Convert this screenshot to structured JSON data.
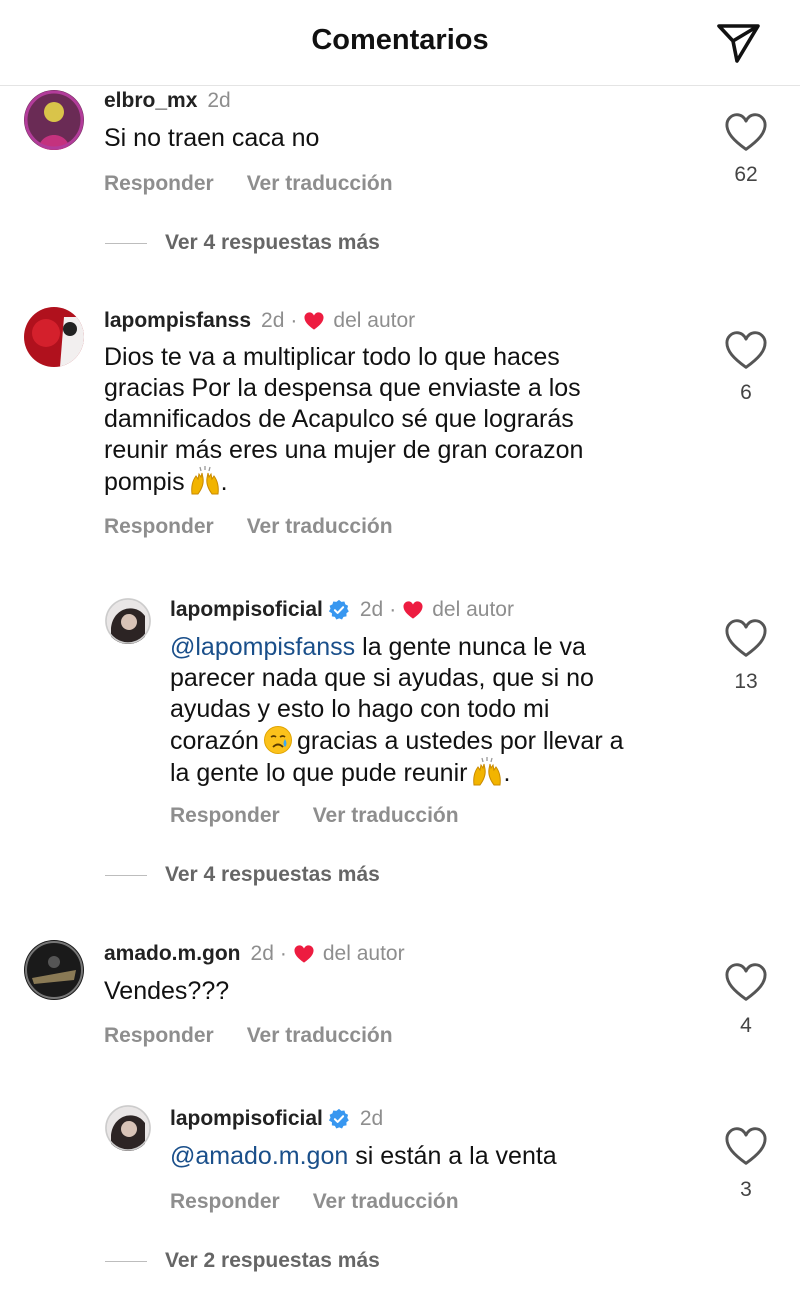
{
  "header": {
    "title": "Comentarios"
  },
  "labels": {
    "reply": "Responder",
    "translate": "Ver traducción",
    "author": "del autor"
  },
  "comments": [
    {
      "user": "elbro_mx",
      "time": "2d",
      "text": "Si no traen caca no",
      "likes": "62",
      "more_replies": "Ver 4 respuestas más"
    },
    {
      "user": "lapompisfanss",
      "time": "2d",
      "liked_by_author": true,
      "lines": [
        "Dios te va a multiplicar todo lo que haces",
        "gracias Por la despensa que enviaste a los",
        "damnificados de Acapulco sé que lograrás",
        "reunir más eres una mujer de gran corazon",
        "pompis"
      ],
      "tail": ".",
      "likes": "6",
      "reply": {
        "user": "lapompisoficial",
        "time": "2d",
        "verified": true,
        "liked_by_author": true,
        "mention": "@lapompisfanss",
        "line1": " la gente nunca le va",
        "lines": [
          "parecer nada que si ayudas, que si no",
          "ayudas y esto lo hago con todo mi"
        ],
        "line4a": "corazón",
        "line4b": "gracias a ustedes por llevar a",
        "line5": "la gente lo que pude reunir",
        "tail": ".",
        "likes": "13"
      },
      "more_replies": "Ver 4 respuestas más"
    },
    {
      "user": "amado.m.gon",
      "time": "2d",
      "liked_by_author": true,
      "text": "Vendes???",
      "likes": "4",
      "reply": {
        "user": "lapompisoficial",
        "time": "2d",
        "verified": true,
        "mention": "@amado.m.gon",
        "text": " si están a la venta",
        "likes": "3"
      },
      "more_replies": "Ver 2 respuestas más"
    }
  ],
  "colors": {
    "heart_red": "#ed1c40",
    "verified_blue": "#3897f0",
    "mention_blue": "#1a4f8a",
    "muted": "#8e8e8e"
  },
  "icons": {
    "share": "paper-plane-icon",
    "like": "heart-outline-icon",
    "author_like": "heart-filled-icon",
    "verified": "verified-badge-icon"
  }
}
